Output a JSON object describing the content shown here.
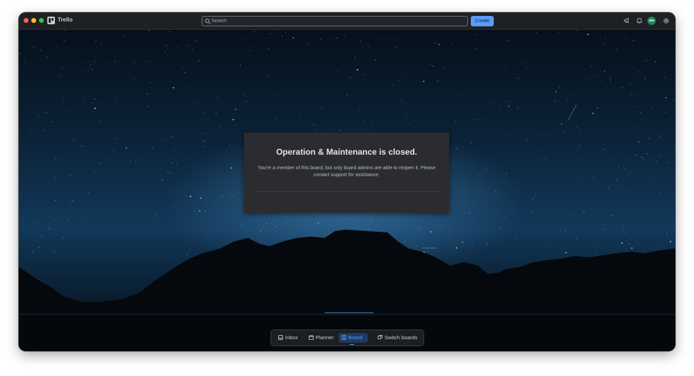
{
  "app": {
    "name": "Trello"
  },
  "topbar": {
    "search": {
      "placeholder": "Search"
    },
    "create_label": "Create",
    "avatar_initials": "MM",
    "icons": [
      "megaphone-icon",
      "bell-icon",
      "gear-icon"
    ]
  },
  "dialog": {
    "title": "Operation & Maintenance is closed.",
    "body": "You're a member of this board, but only board admins are able to reopen it. Please contact support for assistance."
  },
  "bottom_nav": {
    "items": [
      {
        "label": "Inbox",
        "icon": "inbox-icon",
        "active": false
      },
      {
        "label": "Planner",
        "icon": "calendar-icon",
        "active": false
      },
      {
        "label": "Board",
        "icon": "board-icon",
        "active": true
      },
      {
        "label": "Switch boards",
        "icon": "switch-boards-icon",
        "active": false
      }
    ]
  },
  "colors": {
    "accent": "#579dff",
    "avatar": "#1f845a",
    "topbar": "#1f2023",
    "dialog": "#2b2c2f"
  }
}
